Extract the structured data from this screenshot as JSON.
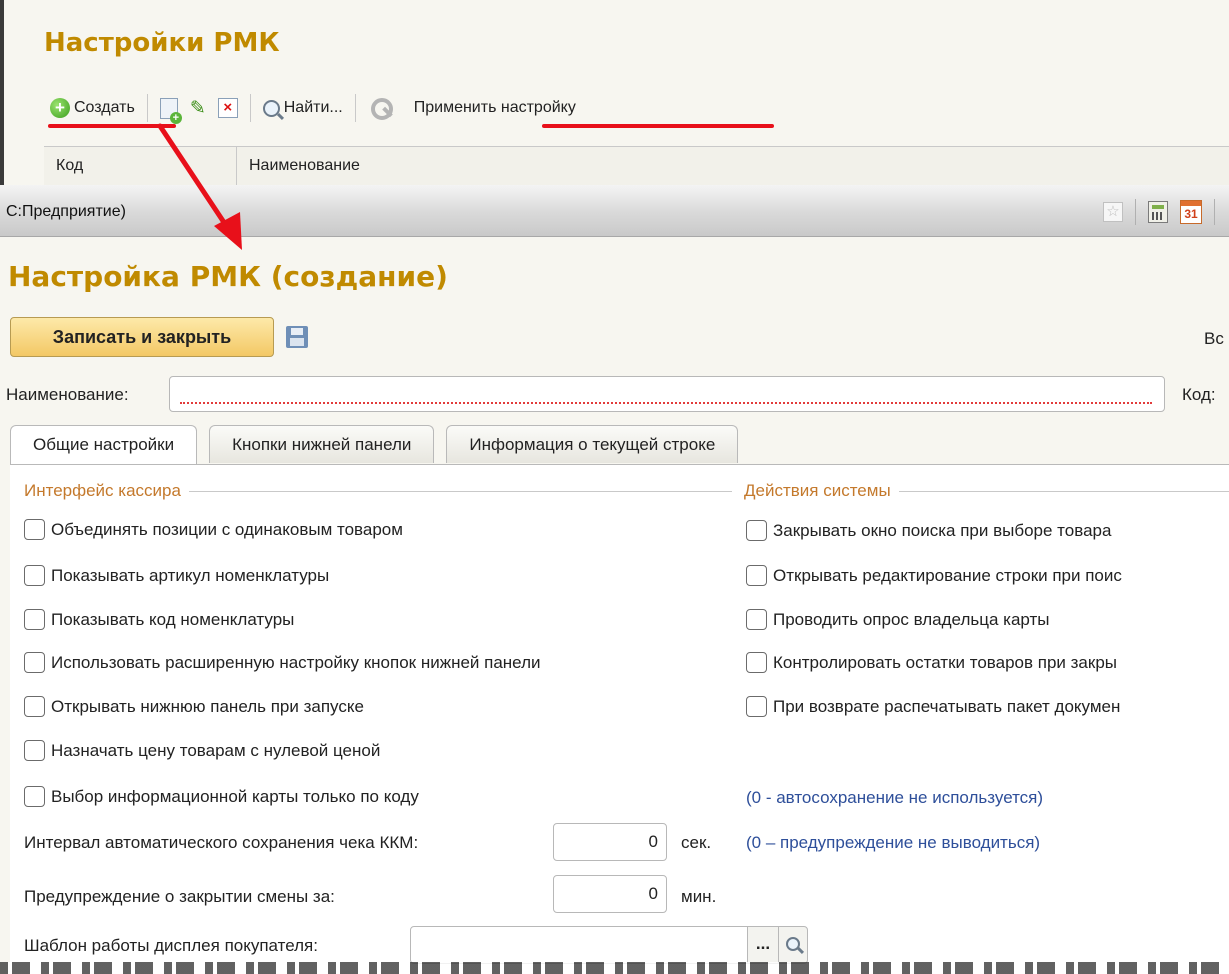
{
  "colors": {
    "accent_title": "#c08a00",
    "annotation_red": "#e8101a",
    "group_title": "#c4792c",
    "hint_blue": "#2e4f9a",
    "button_yellow": "#f3c865"
  },
  "back_window": {
    "title": "Настройки РМК",
    "toolbar": {
      "create_label": "Создать",
      "find_label": "Найти...",
      "apply_settings_label": "Применить настройку"
    },
    "table": {
      "columns": [
        "Код",
        "Наименование"
      ]
    }
  },
  "front_window": {
    "titlebar_text": "С:Предприятие)",
    "title": "Настройка РМК (создание)",
    "save_close_label": "Записать и закрыть",
    "truncated_right_label": "Вс",
    "name_label": "Наименование:",
    "name_value": "",
    "code_label": "Код:",
    "tabs": [
      {
        "label": "Общие настройки"
      },
      {
        "label": "Кнопки нижней панели"
      },
      {
        "label": "Информация о текущей строке"
      }
    ],
    "cashier_group": {
      "title": "Интерфейс кассира",
      "checkboxes": [
        "Объединять позиции с одинаковым товаром",
        "Показывать артикул номенклатуры",
        "Показывать код номенклатуры",
        "Использовать расширенную настройку кнопок нижней панели",
        "Открывать нижнюю панель при запуске",
        "Назначать цену товарам с нулевой ценой",
        "Выбор информационной карты только по коду"
      ]
    },
    "system_group": {
      "title": "Действия системы",
      "checkboxes": [
        "Закрывать окно поиска при выборе товара",
        "Открывать редактирование строки при поис",
        "Проводить опрос владельца карты",
        "Контролировать остатки товаров при закры",
        "При возврате распечатывать пакет докумен"
      ]
    },
    "autosave": {
      "label": "Интервал автоматического сохранения чека ККМ:",
      "value": "0",
      "unit": "сек.",
      "hint": "(0 - автосохранение не используется)"
    },
    "shift_warning": {
      "label": "Предупреждение о закрытии смены за:",
      "value": "0",
      "unit": "мин.",
      "hint": "(0 – предупреждение не выводиться)"
    },
    "display_template": {
      "label": "Шаблон работы дисплея покупателя:",
      "value": "",
      "select_button": "..."
    }
  }
}
